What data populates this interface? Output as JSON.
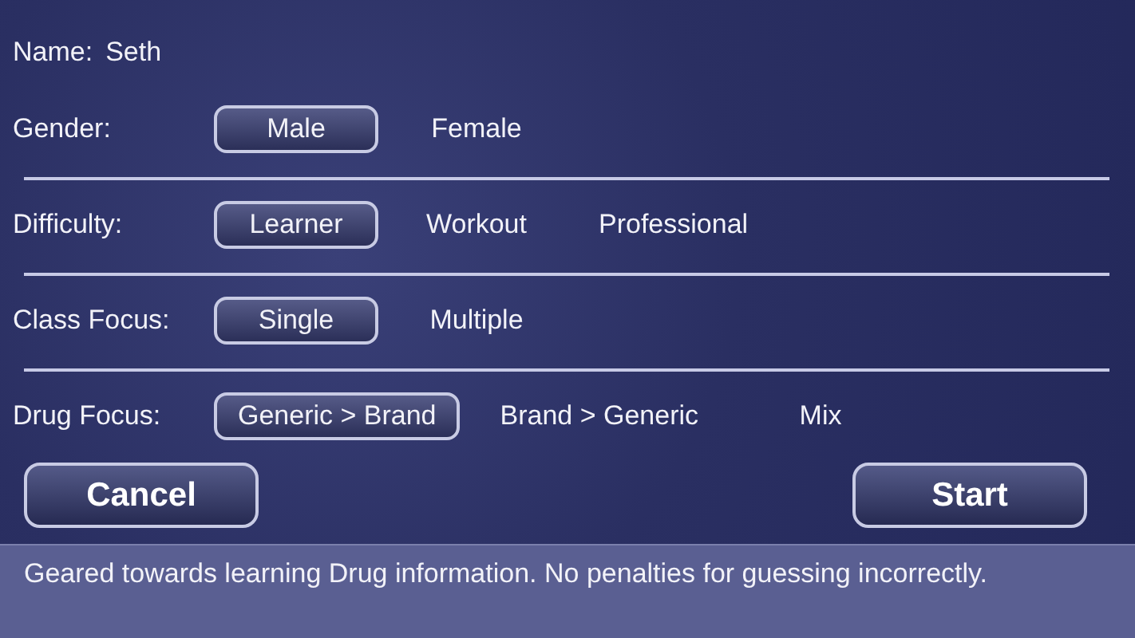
{
  "name": {
    "label": "Name:",
    "value": "Seth"
  },
  "settings": [
    {
      "label": "Gender:",
      "options": [
        {
          "label": "Male",
          "selected": true
        },
        {
          "label": "Female",
          "selected": false
        }
      ]
    },
    {
      "label": "Difficulty:",
      "options": [
        {
          "label": "Learner",
          "selected": true
        },
        {
          "label": "Workout",
          "selected": false
        },
        {
          "label": "Professional",
          "selected": false
        }
      ]
    },
    {
      "label": "Class Focus:",
      "options": [
        {
          "label": "Single",
          "selected": true
        },
        {
          "label": "Multiple",
          "selected": false
        }
      ]
    },
    {
      "label": "Drug Focus:",
      "options": [
        {
          "label": "Generic > Brand",
          "selected": true
        },
        {
          "label": "Brand > Generic",
          "selected": false
        },
        {
          "label": "Mix",
          "selected": false
        }
      ]
    }
  ],
  "buttons": [
    "Cancel",
    "Start"
  ],
  "description": "Geared towards learning Drug information. No penalties for guessing incorrectly."
}
